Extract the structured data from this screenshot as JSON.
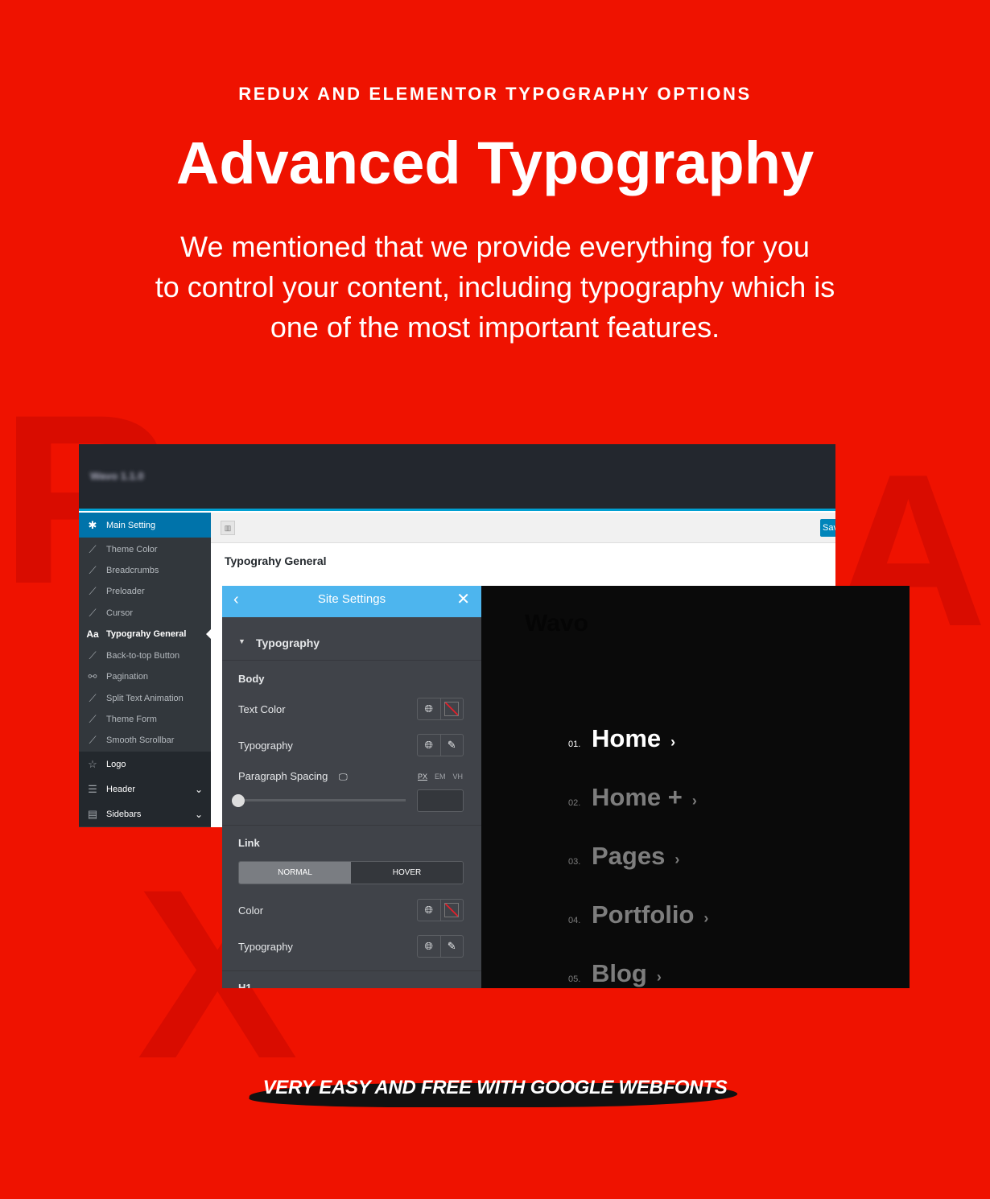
{
  "colors": {
    "background": "#ef1200",
    "accent_blue": "#4db5ee",
    "wp_blue": "#0073aa"
  },
  "decor": {
    "letters": [
      "R",
      "A",
      "X"
    ]
  },
  "hero": {
    "kicker": "REDUX AND ELEMENTOR TYPOGRAPHY OPTIONS",
    "title": "Advanced Typography",
    "lines": [
      "We mentioned that we provide everything for you",
      "to control your content, including typography which is",
      "one of the most important features."
    ]
  },
  "redux": {
    "header_blurred": "Wavo 1.1.0",
    "save_label": "Save",
    "section_title": "Typograhy General",
    "sidebar": [
      {
        "label": "Main Setting",
        "icon": "gear-icon"
      },
      {
        "label": "Theme Color",
        "icon": "brush-icon"
      },
      {
        "label": "Breadcrumbs",
        "icon": "brush-icon"
      },
      {
        "label": "Preloader",
        "icon": "brush-icon"
      },
      {
        "label": "Cursor",
        "icon": "brush-icon"
      },
      {
        "label": "Typograhy General",
        "icon": "font-icon",
        "active": true
      },
      {
        "label": "Back-to-top Button",
        "icon": "brush-icon"
      },
      {
        "label": "Pagination",
        "icon": "link-icon"
      },
      {
        "label": "Split Text Animation",
        "icon": "brush-icon"
      },
      {
        "label": "Theme Form",
        "icon": "brush-icon"
      },
      {
        "label": "Smooth Scrollbar",
        "icon": "brush-icon"
      },
      {
        "label": "Logo",
        "icon": "star-icon"
      },
      {
        "label": "Header",
        "icon": "menu-icon"
      },
      {
        "label": "Sidebars",
        "icon": "grid-icon"
      }
    ]
  },
  "elementor": {
    "title": "Site Settings",
    "section": "Typography",
    "body_label": "Body",
    "text_color": "Text Color",
    "typography": "Typography",
    "paragraph_spacing": "Paragraph Spacing",
    "units": [
      "PX",
      "EM",
      "VH"
    ],
    "selected_unit": "PX",
    "slider_value": 0,
    "link_label": "Link",
    "tabs": [
      "NORMAL",
      "HOVER"
    ],
    "color": "Color",
    "link_typography": "Typography",
    "next_section": "H1"
  },
  "preview": {
    "logo": "Wavo",
    "menu": [
      {
        "num": "01.",
        "label": "Home",
        "active": true
      },
      {
        "num": "02.",
        "label": "Home +"
      },
      {
        "num": "03.",
        "label": "Pages"
      },
      {
        "num": "04.",
        "label": "Portfolio"
      },
      {
        "num": "05.",
        "label": "Blog"
      }
    ]
  },
  "footer_text": "VERY EASY AND FREE WITH GOOGLE WEBFONTS"
}
